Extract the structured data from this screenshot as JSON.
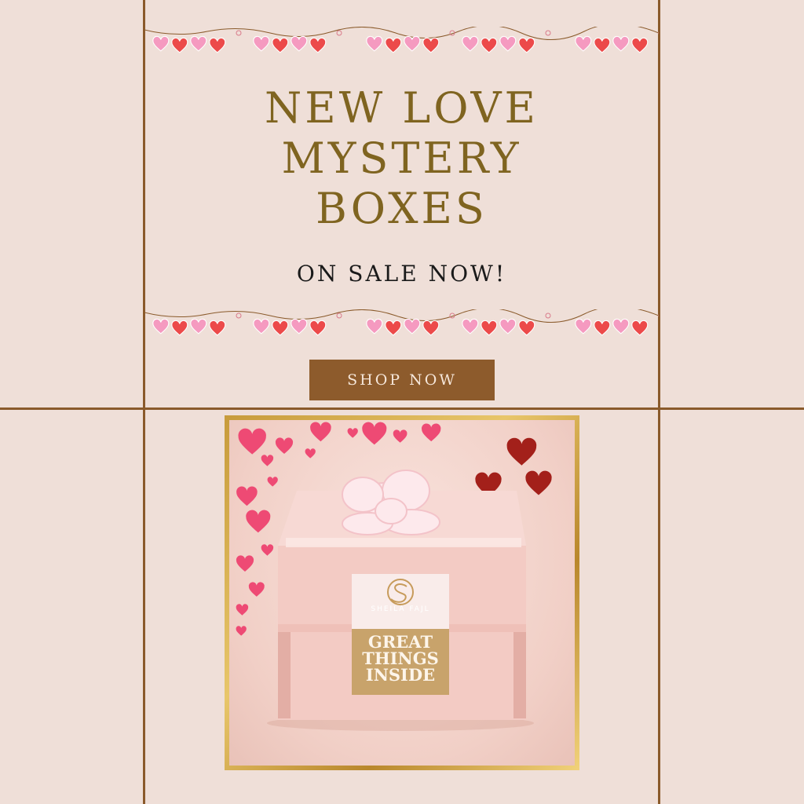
{
  "headline": {
    "line1": "NEW LOVE",
    "line2": "MYSTERY",
    "line3": "BOXES"
  },
  "subheadline": "ON SALE NOW!",
  "cta": {
    "label": "SHOP NOW"
  },
  "product": {
    "brand": "SHEILA FAJL",
    "label_line1": "GREAT",
    "label_line2": "THINGS",
    "label_line3": "INSIDE"
  },
  "colors": {
    "background": "#efdfd8",
    "grid_lines": "#8a5a2b",
    "headline": "#7f6420",
    "button": "#8d5b2c",
    "frame_gold": "#c79b3b",
    "heart_pink": "#ee4a74",
    "heart_red": "#a3201a"
  },
  "icons": {
    "garland": "heart-garland",
    "logo": "sheila-fajl-s-logo"
  }
}
